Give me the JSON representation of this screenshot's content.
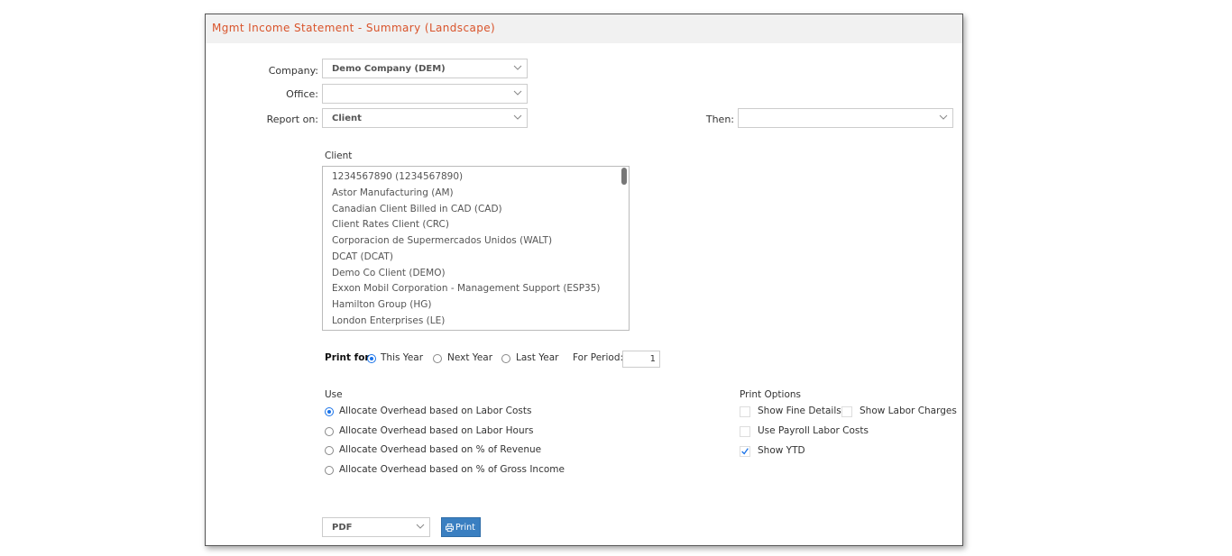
{
  "title": "Mgmt Income Statement - Summary (Landscape)",
  "company": {
    "label": "Company:",
    "value": "Demo Company (DEM)"
  },
  "office": {
    "label": "Office:",
    "value": ""
  },
  "report_on": {
    "label": "Report on:",
    "value": "Client"
  },
  "then": {
    "label": "Then:",
    "value": ""
  },
  "client": {
    "heading": "Client",
    "items": [
      "1234567890 (1234567890)",
      "Astor Manufacturing (AM)",
      "Canadian Client Billed in CAD (CAD)",
      "Client Rates Client (CRC)",
      "Corporacion de Supermercados Unidos (WALT)",
      "DCAT (DCAT)",
      "Demo Co Client (DEMO)",
      "Exxon Mobil Corporation - Management Support (ESP35)",
      "Hamilton Group (HG)",
      "London Enterprises (LE)"
    ]
  },
  "print_for": {
    "label": "Print for:",
    "options": [
      "This Year",
      "Next Year",
      "Last Year"
    ],
    "selected": "This Year",
    "period_label": "For Period:",
    "period_value": "1"
  },
  "use": {
    "heading": "Use",
    "options": [
      "Allocate Overhead based on Labor Costs",
      "Allocate Overhead based on Labor Hours",
      "Allocate Overhead based on % of Revenue",
      "Allocate Overhead based on % of Gross Income"
    ],
    "selected": "Allocate Overhead based on Labor Costs"
  },
  "print_options": {
    "heading": "Print Options",
    "show_fine_details": {
      "label": "Show Fine Details",
      "checked": false
    },
    "show_labor_charges": {
      "label": "Show Labor Charges",
      "checked": false
    },
    "use_payroll_labor_costs": {
      "label": "Use Payroll Labor Costs",
      "checked": false
    },
    "show_ytd": {
      "label": "Show YTD",
      "checked": true
    }
  },
  "output": {
    "format": "PDF",
    "print_label": "Print",
    "print_icon": "printer-icon"
  },
  "colors": {
    "title": "#d9542b",
    "accent": "#1a73e8",
    "button": "#3a7fc1"
  }
}
